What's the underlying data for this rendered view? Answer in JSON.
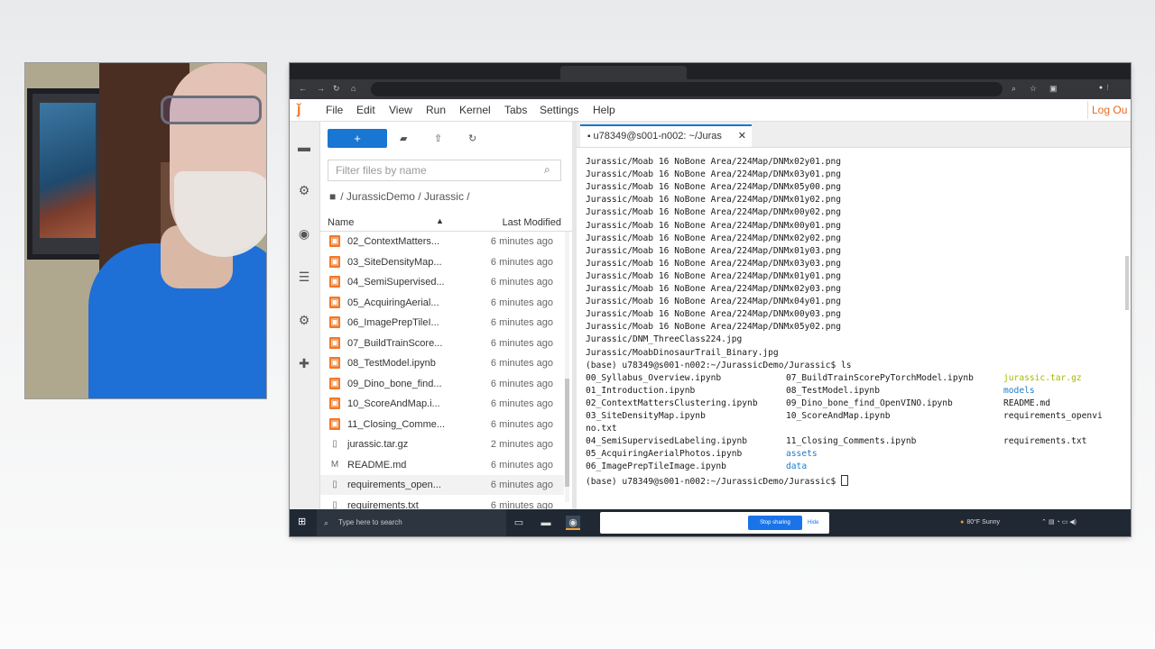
{
  "menu": [
    "File",
    "Edit",
    "View",
    "Run",
    "Kernel",
    "Tabs",
    "Settings",
    "Help"
  ],
  "logout": "Log Ou",
  "filebrowser": {
    "new_label": "+",
    "filter_placeholder": "Filter files by name",
    "breadcrumb": "/ JurassicDemo / Jurassic /",
    "col_name": "Name",
    "col_modified": "Last Modified",
    "files": [
      {
        "name": "02_ContextMatters...",
        "modified": "6 minutes ago",
        "type": "notebook"
      },
      {
        "name": "03_SiteDensityMap...",
        "modified": "6 minutes ago",
        "type": "notebook"
      },
      {
        "name": "04_SemiSupervised...",
        "modified": "6 minutes ago",
        "type": "notebook"
      },
      {
        "name": "05_AcquiringAerial...",
        "modified": "6 minutes ago",
        "type": "notebook"
      },
      {
        "name": "06_ImagePrepTileI...",
        "modified": "6 minutes ago",
        "type": "notebook"
      },
      {
        "name": "07_BuildTrainScore...",
        "modified": "6 minutes ago",
        "type": "notebook"
      },
      {
        "name": "08_TestModel.ipynb",
        "modified": "6 minutes ago",
        "type": "notebook"
      },
      {
        "name": "09_Dino_bone_find...",
        "modified": "6 minutes ago",
        "type": "notebook"
      },
      {
        "name": "10_ScoreAndMap.i...",
        "modified": "6 minutes ago",
        "type": "notebook"
      },
      {
        "name": "11_Closing_Comme...",
        "modified": "6 minutes ago",
        "type": "notebook"
      },
      {
        "name": "jurassic.tar.gz",
        "modified": "2 minutes ago",
        "type": "file"
      },
      {
        "name": "README.md",
        "modified": "6 minutes ago",
        "type": "markdown"
      },
      {
        "name": "requirements_open...",
        "modified": "6 minutes ago",
        "type": "file"
      },
      {
        "name": "requirements.txt",
        "modified": "6 minutes ago",
        "type": "file"
      }
    ]
  },
  "terminal": {
    "tab_title": "u78349@s001-n002: ~/Juras",
    "lines": [
      "Jurassic/Moab 16 NoBone Area/224Map/DNMx02y01.png",
      "Jurassic/Moab 16 NoBone Area/224Map/DNMx03y01.png",
      "Jurassic/Moab 16 NoBone Area/224Map/DNMx05y00.png",
      "Jurassic/Moab 16 NoBone Area/224Map/DNMx01y02.png",
      "Jurassic/Moab 16 NoBone Area/224Map/DNMx00y02.png",
      "Jurassic/Moab 16 NoBone Area/224Map/DNMx00y01.png",
      "Jurassic/Moab 16 NoBone Area/224Map/DNMx02y02.png",
      "Jurassic/Moab 16 NoBone Area/224Map/DNMx01y03.png",
      "Jurassic/Moab 16 NoBone Area/224Map/DNMx03y03.png",
      "Jurassic/Moab 16 NoBone Area/224Map/DNMx01y01.png",
      "Jurassic/Moab 16 NoBone Area/224Map/DNMx02y03.png",
      "Jurassic/Moab 16 NoBone Area/224Map/DNMx04y01.png",
      "Jurassic/Moab 16 NoBone Area/224Map/DNMx00y03.png",
      "Jurassic/Moab 16 NoBone Area/224Map/DNMx05y02.png",
      "Jurassic/DNM_ThreeClass224.jpg",
      "Jurassic/MoabDinosaurTrail_Binary.jpg",
      "(base) u78349@s001-n002:~/JurassicDemo/Jurassic$ ls"
    ],
    "ls": [
      [
        "00_Syllabus_Overview.ipynb",
        "07_BuildTrainScorePyTorchModel.ipynb",
        "jurassic.tar.gz"
      ],
      [
        "01_Introduction.ipynb",
        "08_TestModel.ipynb",
        "models"
      ],
      [
        "02_ContextMattersClustering.ipynb",
        "09_Dino_bone_find_OpenVINO.ipynb",
        "README.md"
      ],
      [
        "03_SiteDensityMap.ipynb",
        "10_ScoreAndMap.ipynb",
        "requirements_openvi"
      ],
      [
        "no.txt",
        "",
        ""
      ],
      [
        "04_SemiSupervisedLabeling.ipynb",
        "11_Closing_Comments.ipynb",
        "requirements.txt"
      ],
      [
        "05_AcquiringAerialPhotos.ipynb",
        "assets",
        ""
      ],
      [
        "06_ImagePrepTileImage.ipynb",
        "data",
        ""
      ]
    ],
    "prompt": "(base) u78349@s001-n002:~/JurassicDemo/Jurassic$ "
  },
  "taskbar": {
    "search_placeholder": "Type here to search",
    "stop_sharing": "Stop sharing",
    "hide": "Hide",
    "weather": "80°F Sunny"
  }
}
